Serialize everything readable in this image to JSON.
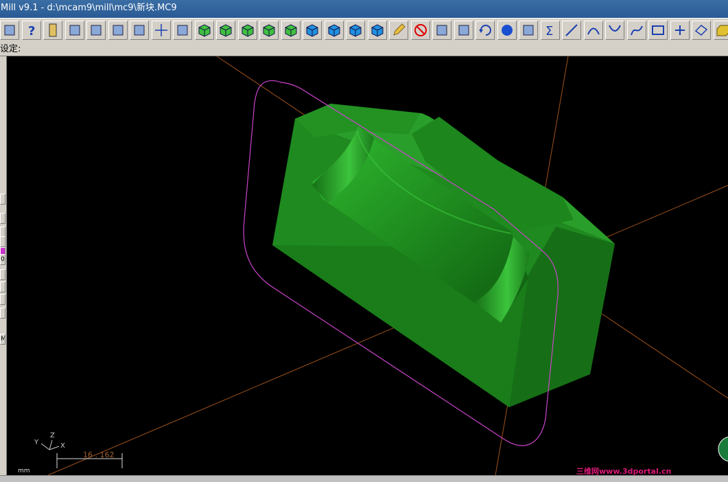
{
  "window": {
    "title": "Mill v9.1 - d:\\mcam9\\mill\\mc9\\新块.MC9"
  },
  "prompt": {
    "text": "设定:"
  },
  "toolbar": {
    "buttons": [
      {
        "name": "unknown-icon"
      },
      {
        "name": "help-icon"
      },
      {
        "name": "calculator-icon"
      },
      {
        "name": "analyze-icon"
      },
      {
        "name": "zoom-prev-icon"
      },
      {
        "name": "zoom-window-icon"
      },
      {
        "name": "zoom-fit-icon"
      },
      {
        "name": "pan-icon"
      },
      {
        "name": "select-icon"
      },
      {
        "name": "rotate-view-icon"
      },
      {
        "name": "iso-view-icon"
      },
      {
        "name": "top-view-icon"
      },
      {
        "name": "front-view-icon"
      },
      {
        "name": "side-view-icon"
      },
      {
        "name": "cube-view-1-icon"
      },
      {
        "name": "cube-view-2-icon"
      },
      {
        "name": "cube-view-3-icon"
      },
      {
        "name": "cube-view-4-icon"
      },
      {
        "name": "pencil-icon"
      },
      {
        "name": "no-entry-icon"
      },
      {
        "name": "transform-1-icon"
      },
      {
        "name": "transform-2-icon"
      },
      {
        "name": "undo-icon"
      },
      {
        "name": "shade-sphere-icon"
      },
      {
        "name": "layers-icon"
      },
      {
        "name": "sum-icon"
      },
      {
        "name": "line-icon"
      },
      {
        "name": "arc-icon"
      },
      {
        "name": "fillet-icon"
      },
      {
        "name": "spline-icon"
      },
      {
        "name": "rectangle-icon"
      },
      {
        "name": "point-icon"
      },
      {
        "name": "surface-icon"
      },
      {
        "name": "solid-icon"
      }
    ]
  },
  "left_panel": {
    "labels": [
      "",
      "",
      "",
      "",
      "",
      "0",
      "",
      "",
      "",
      "",
      "M"
    ]
  },
  "viewport": {
    "axis_indicator": {
      "y": "Y",
      "z": "Z",
      "x": "X"
    },
    "scale_text": "16 . 162",
    "units": "mm",
    "watermark": "三维网www.3dportal.cn",
    "colors": {
      "solid": "#1f8a1f",
      "boundary": "#cc44cc",
      "axes": "#a0521a",
      "background": "#000000"
    }
  }
}
